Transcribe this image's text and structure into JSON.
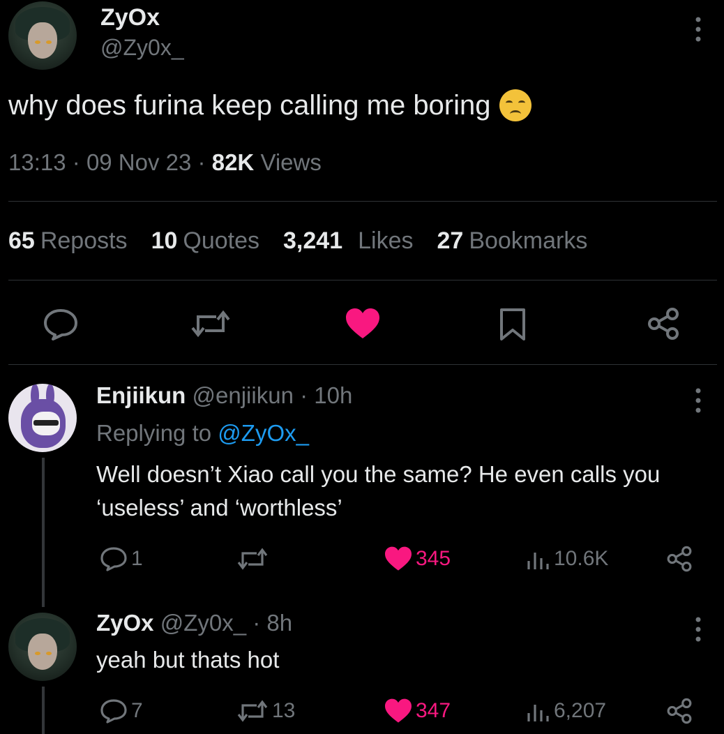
{
  "main_tweet": {
    "author": {
      "name": "ZyOx",
      "handle": "@Zy0x_"
    },
    "text": "why does furina keep calling me boring",
    "emoji": "disappointed-face",
    "time": "13:13",
    "date": "09 Nov 23",
    "views_count": "82K",
    "views_label": "Views",
    "sep": "·",
    "stats": {
      "reposts_count": "65",
      "reposts_label": "Reposts",
      "quotes_count": "10",
      "quotes_label": "Quotes",
      "likes_count": "3,241",
      "likes_label": "Likes",
      "bookmarks_count": "27",
      "bookmarks_label": "Bookmarks"
    },
    "actions": [
      "reply-icon",
      "repost-icon",
      "like-icon",
      "bookmark-icon",
      "share-icon"
    ],
    "like_color": "#f91880"
  },
  "replies": [
    {
      "name": "Enjiikun",
      "handle": "@enjiikun",
      "time": "· 10h",
      "replying_prefix": "Replying to",
      "replying_handle": "@ZyOx_",
      "text_line1": "Well doesn’t Xiao call you the same? He even calls you",
      "text_line2": "‘useless’ and ‘worthless’",
      "reply_count": "1",
      "repost_count": "",
      "like_count": "345",
      "views_count": "10.6K"
    },
    {
      "name": "ZyOx",
      "handle": "@Zy0x_",
      "time": "· 8h",
      "text_line1": "yeah but thats hot",
      "reply_count": "7",
      "repost_count": "13",
      "like_count": "347",
      "views_count": "6,207"
    }
  ],
  "colors": {
    "accent": "#1d9bf0",
    "like": "#f91880",
    "muted": "#71767b",
    "text": "#e7e9ea",
    "background": "#000000"
  }
}
